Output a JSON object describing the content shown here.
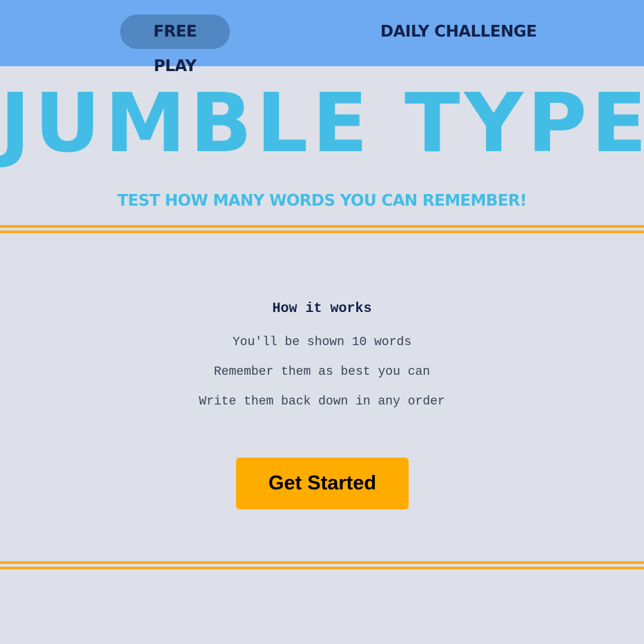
{
  "nav": {
    "free_play": "FREE PLAY",
    "daily_challenge": "DAILY CHALLENGE",
    "active_tab": "free_play"
  },
  "header": {
    "title": "JUMBLE TYPE",
    "subtitle": "TEST HOW MANY WORDS YOU CAN REMEMBER!"
  },
  "how_it_works": {
    "heading": "How it works",
    "steps": [
      "You'll be shown 10 words",
      "Remember them as best you can",
      "Write them back down in any order"
    ]
  },
  "cta": {
    "label": "Get Started"
  },
  "colors": {
    "topbar": "#6eaaf2",
    "active_tab": "#5188c2",
    "title": "#44bde6",
    "accent_rule": "#fbab18",
    "button": "#ffac00",
    "background": "#dde0e8"
  }
}
